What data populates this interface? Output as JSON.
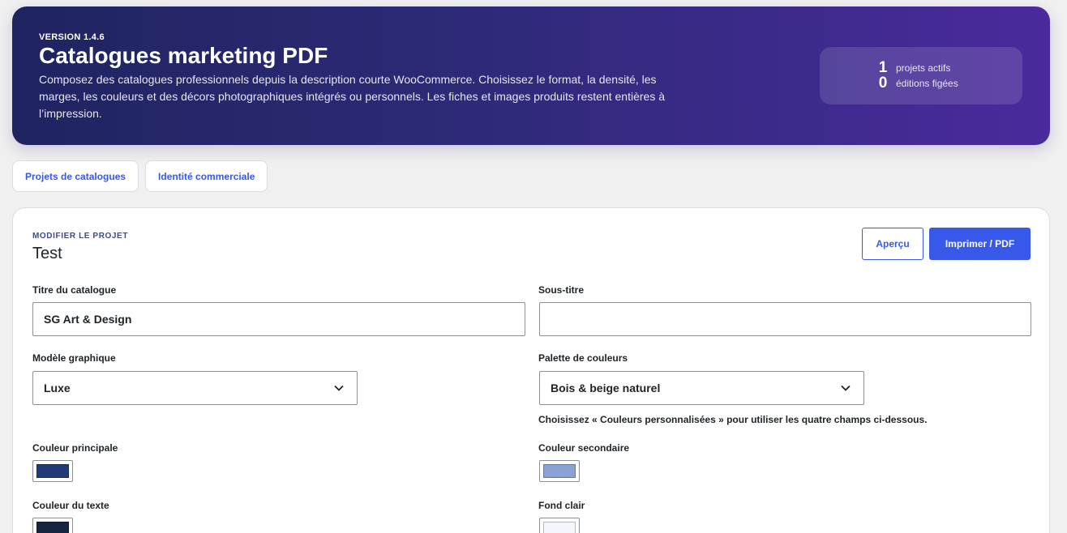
{
  "hero": {
    "version": "VERSION 1.4.6",
    "title": "Catalogues marketing PDF",
    "description": "Composez des catalogues professionnels depuis la description courte WooCommerce. Choisissez le format, la densité, les marges, les couleurs et des décors photographiques intégrés ou personnels. Les fiches et images produits restent entières à l’impression."
  },
  "stats": {
    "active_projects": {
      "value": "1",
      "label": "projets actifs"
    },
    "frozen_editions": {
      "value": "0",
      "label": "éditions figées"
    }
  },
  "tabs": [
    {
      "label": "Projets de catalogues"
    },
    {
      "label": "Identité commerciale"
    }
  ],
  "project": {
    "eyebrow": "MODIFIER LE PROJET",
    "name": "Test",
    "preview_label": "Aperçu",
    "print_label": "Imprimer / PDF"
  },
  "form": {
    "catalog_title": {
      "label": "Titre du catalogue",
      "value": "SG Art & Design"
    },
    "subtitle": {
      "label": "Sous-titre",
      "value": ""
    },
    "template": {
      "label": "Modèle graphique",
      "value": "Luxe"
    },
    "palette": {
      "label": "Palette de couleurs",
      "value": "Bois & beige naturel",
      "hint": "Choisissez « Couleurs personnalisées » pour utiliser les quatre champs ci-dessous."
    },
    "colors": {
      "primary": {
        "label": "Couleur principale",
        "hex": "#223a78"
      },
      "secondary": {
        "label": "Couleur secondaire",
        "hex": "#8ca2d6"
      },
      "text": {
        "label": "Couleur du texte",
        "hex": "#172640"
      },
      "light_bg": {
        "label": "Fond clair",
        "hex": "#f3f6fb"
      }
    }
  },
  "theme": {
    "accent": "#3858e9",
    "hero_start": "#1f2460",
    "hero_end": "#4a2a9c"
  }
}
